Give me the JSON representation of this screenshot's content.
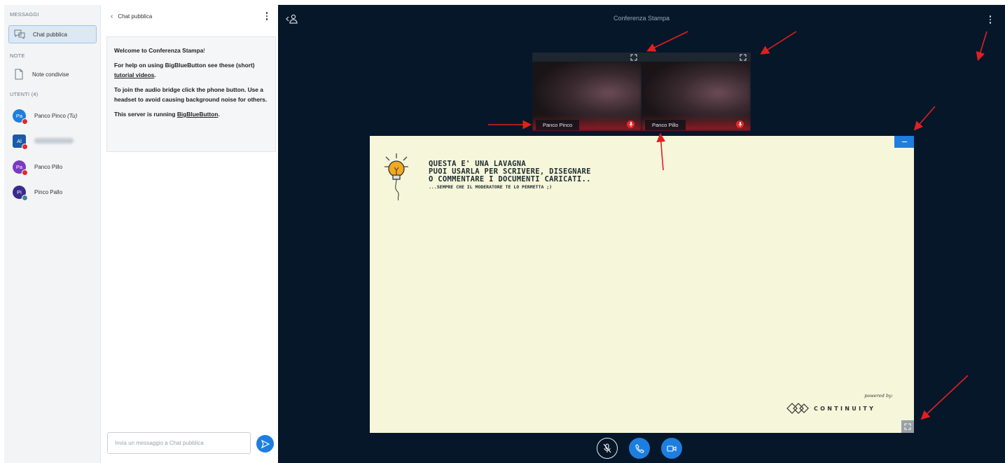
{
  "sidebar": {
    "messages_title": "MESSAGGI",
    "public_chat": "Chat pubblica",
    "notes_title": "NOTE",
    "shared_notes": "Note condivise",
    "users_title": "UTENTI (4)",
    "users": [
      {
        "initials": "Pa",
        "name": "Panco Pinco",
        "suffix": "(Tu)",
        "color": "#1e7ee0",
        "badge": "muted"
      },
      {
        "initials": "Al",
        "name": "",
        "suffix": "",
        "color": "#1b5aa8",
        "badge": "muted",
        "blurred": true
      },
      {
        "initials": "Pa",
        "name": "Panco Pillo",
        "suffix": "",
        "color": "#7a3bc2",
        "badge": "muted"
      },
      {
        "initials": "Pi",
        "name": "Pinco Pallo",
        "suffix": "",
        "color": "#3a2a8e",
        "badge": "listen"
      }
    ]
  },
  "chat": {
    "header": "Chat pubblica",
    "welcome_prefix": "Welcome to ",
    "welcome_name": "Conferenza Stampa",
    "welcome_suffix": "!",
    "help_prefix": "For help on using BigBlueButton see these (short) ",
    "help_link": "tutorial videos",
    "help_suffix": ".",
    "audio_text": "To join the audio bridge click the phone button. Use a headset to avoid causing background noise for others.",
    "server_prefix": "This server is running ",
    "server_link": "BigBlueButton",
    "server_suffix": ".",
    "input_placeholder": "Invia un messaggio a Chat pubblica"
  },
  "stage": {
    "title": "Conferenza Stampa",
    "cameras": [
      {
        "name": "Panco Pinco"
      },
      {
        "name": "Panco Pillo"
      }
    ],
    "whiteboard": {
      "line1": "QUESTA E' UNA LAVAGNA",
      "line2": "PUOI USARLA PER SCRIVERE, DISEGNARE",
      "line3": "O COMMENTARE I DOCUMENTI CARICATI..",
      "line4": "...SEMPRE CHE IL MODERATORE TE LO PERMETTA ;)",
      "powered": "powered by:",
      "brand": "CONTINUITY"
    }
  },
  "colors": {
    "accent": "#1e7ee0",
    "stage_bg": "#06172a",
    "whiteboard_bg": "#f6f6db",
    "annotation": "#e02020"
  },
  "icons": [
    "chat-bubbles-icon",
    "document-icon",
    "back-chevron-icon",
    "kebab-menu-icon",
    "send-icon",
    "users-toggle-icon",
    "expand-icon",
    "muted-mic-icon",
    "phone-icon",
    "camera-icon",
    "minimize-icon",
    "lightbulb-icon",
    "continuity-logo"
  ]
}
